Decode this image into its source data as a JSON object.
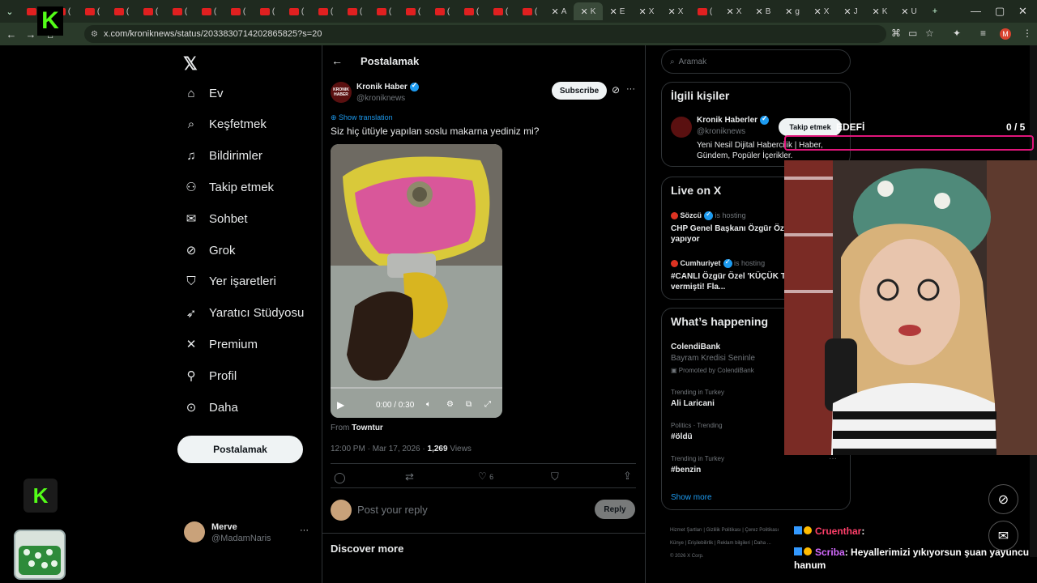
{
  "browser": {
    "tab_labels": [
      "(",
      "(",
      "(",
      "(",
      "(",
      "(",
      "(",
      "(",
      "(",
      "(",
      "(",
      "(",
      "(",
      "(",
      "(",
      "(",
      "(",
      "(",
      "A",
      "K",
      "E",
      "X",
      "X",
      "(",
      "X",
      "B",
      "g",
      "X",
      "J",
      "K",
      "U"
    ],
    "new_tab": "+",
    "url": "x.com/kroniknews/status/2033830714202865825?s=20",
    "profile_initial": "M"
  },
  "left_nav": {
    "items": [
      {
        "label": "Ev",
        "icon": "home-icon"
      },
      {
        "label": "Keşfetmek",
        "icon": "search-icon"
      },
      {
        "label": "Bildirimler",
        "icon": "bell-icon"
      },
      {
        "label": "Takip etmek",
        "icon": "follow-icon"
      },
      {
        "label": "Sohbet",
        "icon": "mail-icon"
      },
      {
        "label": "Grok",
        "icon": "grok-icon"
      },
      {
        "label": "Yer işaretleri",
        "icon": "bookmark-icon"
      },
      {
        "label": "Yaratıcı Stüdyosu",
        "icon": "rocket-icon"
      },
      {
        "label": "Premium",
        "icon": "x-icon"
      },
      {
        "label": "Profil",
        "icon": "person-icon"
      },
      {
        "label": "Daha",
        "icon": "more-icon"
      }
    ],
    "post_button": "Postalamak",
    "account": {
      "name": "Merve",
      "handle": "@MadamNaris",
      "more": "···"
    }
  },
  "main": {
    "header_title": "Postalamak",
    "author": {
      "name": "Kronik Haber",
      "handle": "@kroniknews",
      "avatar_text": "KRONIK HABER"
    },
    "subscribe": "Subscribe",
    "more": "···",
    "show_translation": "Show translation",
    "text": "Siz hiç ütüyle yapılan soslu makarna yediniz mi?",
    "video": {
      "time": "0:00 / 0:30"
    },
    "from_label": "From",
    "from_name": "Towntur",
    "meta": "12:00 PM · Mar 17, 2026 ·",
    "views_count": "1,269",
    "views_label": "Views",
    "likes": "6",
    "reply_placeholder": "Post your reply",
    "reply_button": "Reply",
    "discover": "Discover more"
  },
  "sidebar": {
    "search_placeholder": "Aramak",
    "related": {
      "title": "İlgili kişiler",
      "name": "Kronik Haberler",
      "handle": "@kroniknews",
      "bio": "Yeni Nesil Dijital Habercilik | Haber, Gündem, Popüler İçerikler.",
      "follow": "Takip etmek"
    },
    "live": {
      "title": "Live on X",
      "items": [
        {
          "host": "Sözcü",
          "status": "is hosting",
          "text": "CHP Genel Başkanı Özgür Özel açıklama yapıyor"
        },
        {
          "host": "Cumhuriyet",
          "status": "is hosting",
          "text": "#CANLI Özgür Özel 'KÜÇÜK TURP' için saat vermişti! Fla..."
        }
      ]
    },
    "happening": {
      "title": "What’s happening",
      "promo": {
        "name": "ColendiBank",
        "desc": "Bayram Kredisi Seninle",
        "promoted": "Promoted by ColendiBank"
      },
      "trends": [
        {
          "context": "Trending in Turkey",
          "name": "Ali Laricani"
        },
        {
          "context": "Politics · Trending",
          "name": "#öldü"
        },
        {
          "context": "Trending in Turkey",
          "name": "#benzin"
        }
      ],
      "show_more": "Show more"
    },
    "footer": {
      "line1": [
        "Hizmet Şartları",
        "Gizlilik Politikası",
        "Çerez Politikası"
      ],
      "line2": [
        "Künye",
        "Erişilebilirlik",
        "Reklam bilgileri",
        "Daha ..."
      ],
      "copyright": "© 2026 X Corp."
    }
  },
  "overlay": {
    "goal_label": "EDEFİ",
    "goal_count": "0 / 5",
    "chat": [
      {
        "user": "Cruenthar",
        "text": ""
      },
      {
        "user": "Scriba",
        "text": "Heyallerimizi yıkıyorsun şuan yayuncu hanum"
      }
    ],
    "kick_logo": "K"
  },
  "colors": {
    "accent": "#1d9bf0",
    "chrome": "#2a3a2a",
    "goal_border": "#e0157a",
    "kick_green": "#53fc18"
  }
}
